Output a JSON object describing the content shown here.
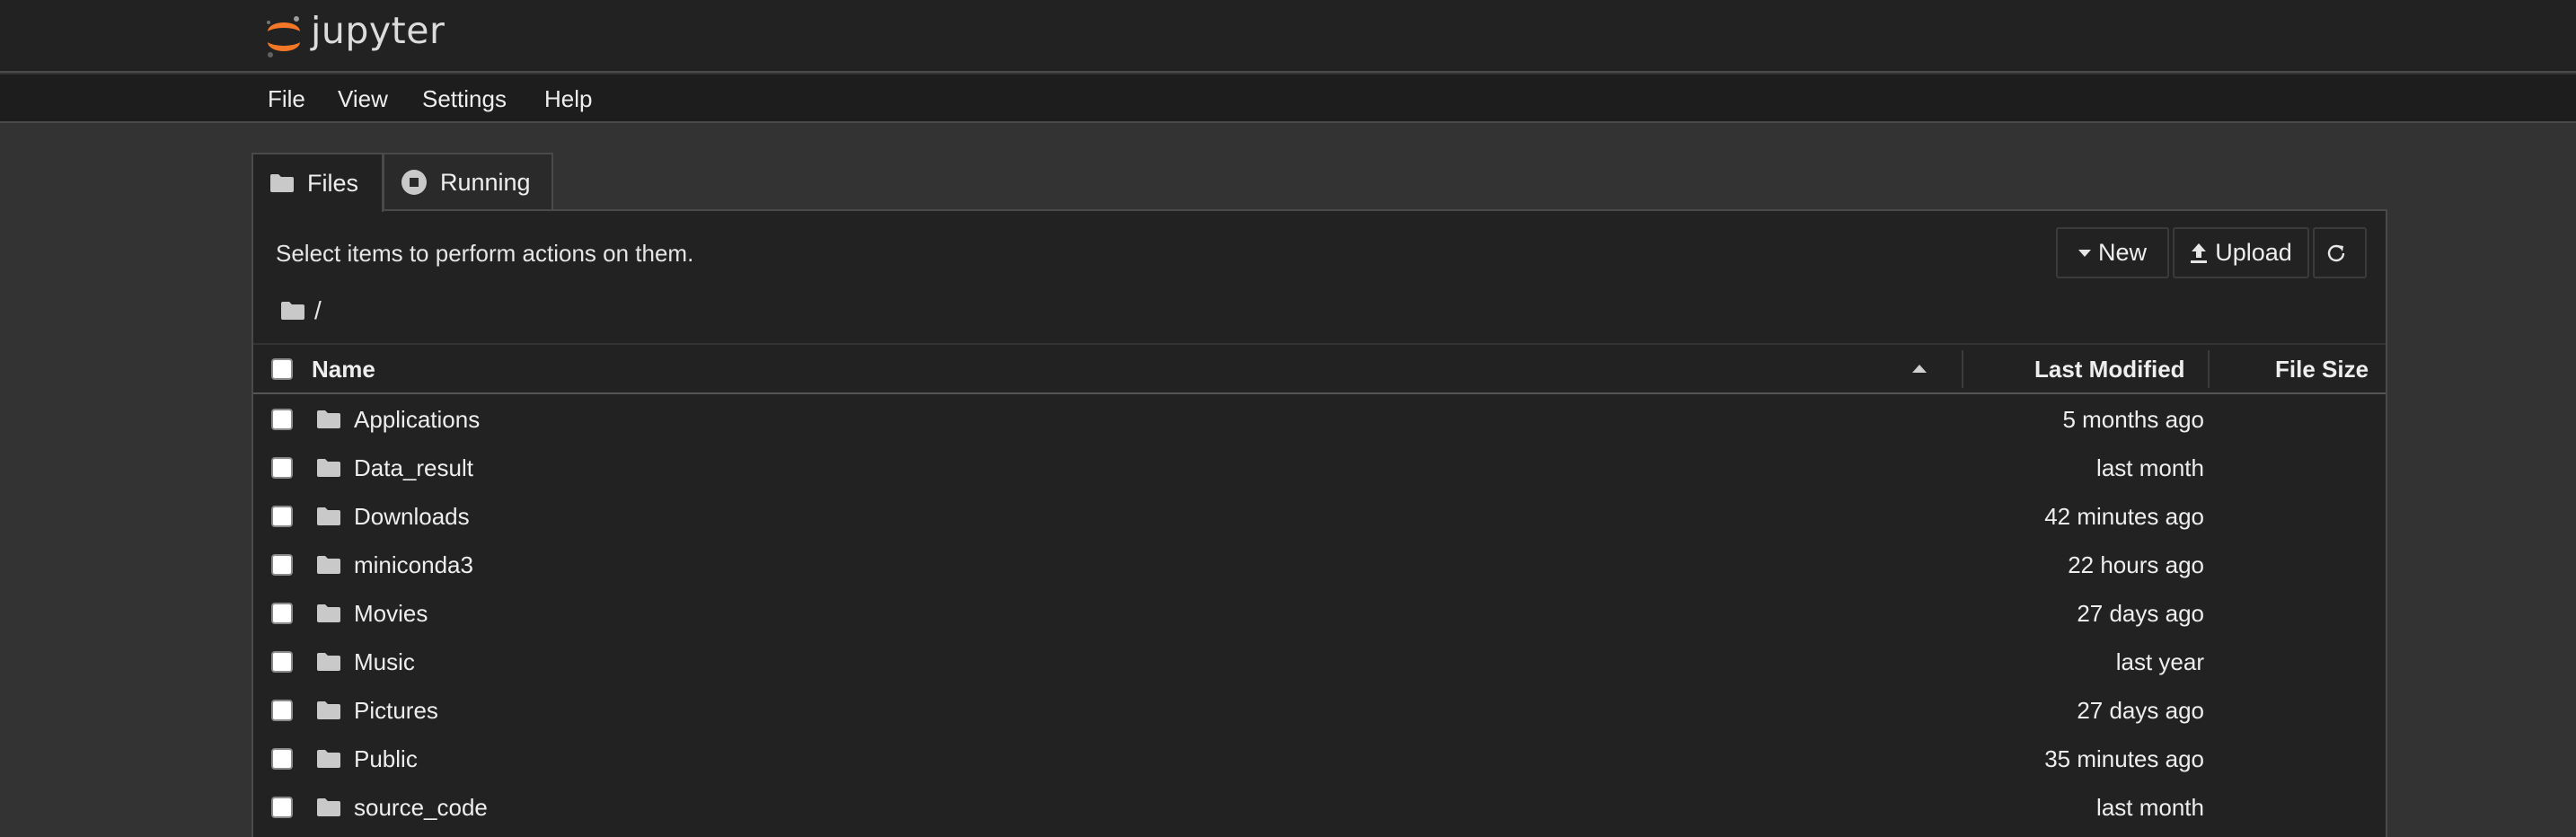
{
  "app": {
    "logo_text": "jupyter",
    "brand_color": "#f37726"
  },
  "menu": [
    "File",
    "View",
    "Settings",
    "Help"
  ],
  "tabs": [
    {
      "label": "Files",
      "icon": "folder-icon",
      "active": true
    },
    {
      "label": "Running",
      "icon": "stop-circle-icon",
      "active": false
    }
  ],
  "toolbar": {
    "hint": "Select items to perform actions on them.",
    "new_label": "New",
    "upload_label": "Upload",
    "refresh_icon": "refresh-icon"
  },
  "breadcrumb": {
    "icon": "folder-icon",
    "path": "/"
  },
  "table": {
    "columns": {
      "name": "Name",
      "modified": "Last Modified",
      "size": "File Size"
    },
    "sort": {
      "column": "Name",
      "direction": "ascending"
    },
    "rows": [
      {
        "name": "Applications",
        "modified": "5 months ago",
        "type": "folder"
      },
      {
        "name": "Data_result",
        "modified": "last month",
        "type": "folder"
      },
      {
        "name": "Downloads",
        "modified": "42 minutes ago",
        "type": "folder"
      },
      {
        "name": "miniconda3",
        "modified": "22 hours ago",
        "type": "folder"
      },
      {
        "name": "Movies",
        "modified": "27 days ago",
        "type": "folder"
      },
      {
        "name": "Music",
        "modified": "last year",
        "type": "folder"
      },
      {
        "name": "Pictures",
        "modified": "27 days ago",
        "type": "folder"
      },
      {
        "name": "Public",
        "modified": "35 minutes ago",
        "type": "folder"
      },
      {
        "name": "source_code",
        "modified": "last month",
        "type": "folder"
      }
    ]
  }
}
